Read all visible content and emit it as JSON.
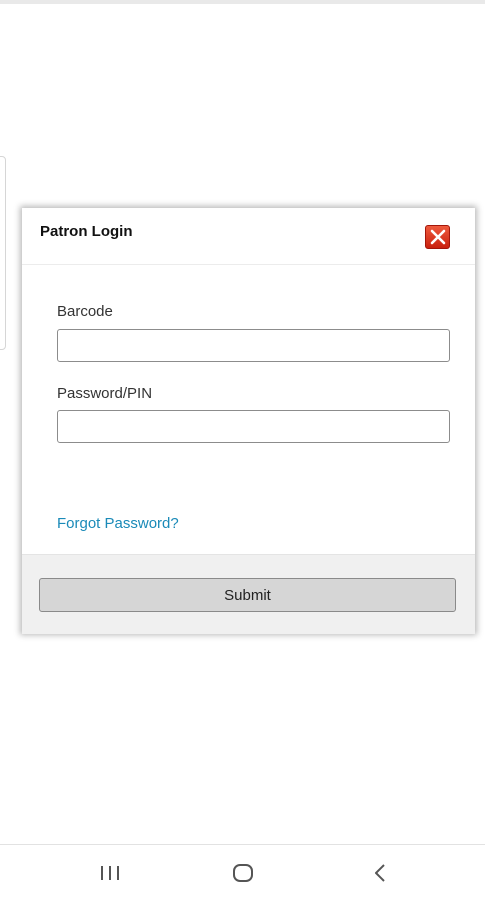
{
  "modal": {
    "title": "Patron Login",
    "close_icon": "close-icon",
    "barcode": {
      "label": "Barcode",
      "value": "",
      "placeholder": ""
    },
    "password": {
      "label": "Password/PIN",
      "value": "",
      "placeholder": ""
    },
    "forgot_password_link": "Forgot Password?",
    "submit_label": "Submit"
  },
  "colors": {
    "link": "#1a8ab8",
    "close_button": "#d8301a",
    "footer_background": "#f0f0f0"
  },
  "navigation_bar": {
    "buttons": [
      "recent-apps-icon",
      "home-icon",
      "back-icon"
    ]
  }
}
